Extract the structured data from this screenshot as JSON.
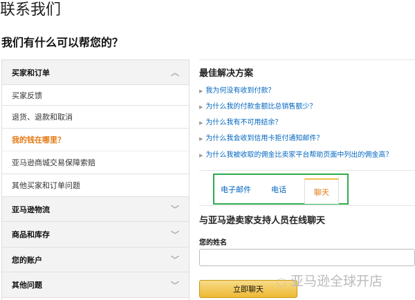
{
  "page": {
    "title": "联系我们",
    "subtitle": "我们有什么可以帮您的？"
  },
  "left": {
    "sections": [
      {
        "label": "买家和订单",
        "expanded": true,
        "items": [
          "买家反馈",
          "退货、退款和取消",
          "我的钱在哪里？",
          "亚马逊商城交易保障索赔",
          "其他买家和订单问题"
        ],
        "active_item": "我的钱在哪里？"
      },
      {
        "label": "亚马逊物流"
      },
      {
        "label": "商品和库存"
      },
      {
        "label": "您的账户"
      },
      {
        "label": "其他问题"
      }
    ]
  },
  "right": {
    "best_title": "最佳解决方案",
    "links": [
      "我为何没有收到付款？",
      "为什么我的付款金额比总销售额少？",
      "为什么我有不可用结余？",
      "为什么我会收到信用卡拒付通知邮件？",
      "为什么我被收取的佣金比卖家平台帮助页面中列出的佣金高？"
    ],
    "tabs": [
      "电子邮件",
      "电话",
      "聊天"
    ],
    "active_tab": "聊天",
    "chat_heading": "与亚马逊卖家支持人员在线聊天",
    "name_label": "您的姓名",
    "name_value": "",
    "chat_button": "立即聊天"
  },
  "watermark": "亚马逊全球开店",
  "colors": {
    "accent": "#e47911",
    "link": "#0066c0",
    "highlight": "#2eaa4f"
  }
}
